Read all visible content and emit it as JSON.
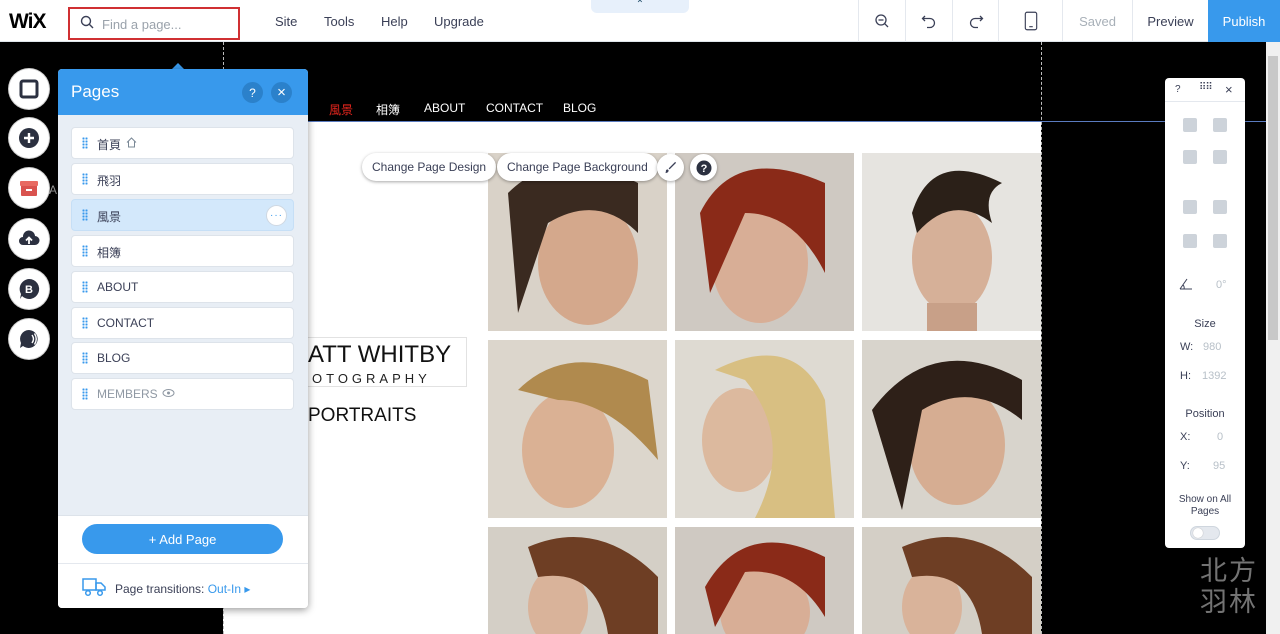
{
  "topbar": {
    "logo": "WiX",
    "search_placeholder": "Find a page...",
    "menu": [
      "Site",
      "Tools",
      "Help",
      "Upgrade"
    ],
    "nub": "⌃",
    "saved": "Saved",
    "preview": "Preview",
    "publish": "Publish"
  },
  "left_tools": {
    "partial_label": "A"
  },
  "site": {
    "nav": [
      "風景",
      "相簿",
      "ABOUT",
      "CONTACT",
      "BLOG"
    ],
    "nav_active_color": "#e8261e",
    "brand_line1": "ATT WHITBY",
    "brand_line2": "OTOGRAPHY",
    "section_title": "PORTRAITS",
    "change_design": "Change Page Design",
    "change_background": "Change Page Background"
  },
  "pages_panel": {
    "title": "Pages",
    "help": "?",
    "close": "×",
    "pages": [
      {
        "label": "首頁",
        "icon": "home-icon"
      },
      {
        "label": "飛羽"
      },
      {
        "label": "風景",
        "selected": true,
        "more": "···"
      },
      {
        "label": "相簿"
      },
      {
        "label": "ABOUT"
      },
      {
        "label": "CONTACT"
      },
      {
        "label": "BLOG"
      },
      {
        "label": "MEMBERS",
        "icon": "eye-icon",
        "dimmed": true
      }
    ],
    "add_page": "+  Add Page",
    "transitions_label": "Page transitions: ",
    "transitions_value": "Out-In ▸"
  },
  "right_panel": {
    "help": "?",
    "close": "×",
    "rotation": "0°",
    "size_label": "Size",
    "w_label": "W:",
    "w_value": "980",
    "h_label": "H:",
    "h_value": "1392",
    "position_label": "Position",
    "x_label": "X:",
    "x_value": "0",
    "y_label": "Y:",
    "y_value": "95",
    "show_all_label": "Show on All Pages"
  },
  "watermark": "北方羽林",
  "colors": {
    "accent": "#3899ec",
    "highlight": "#d03033"
  }
}
